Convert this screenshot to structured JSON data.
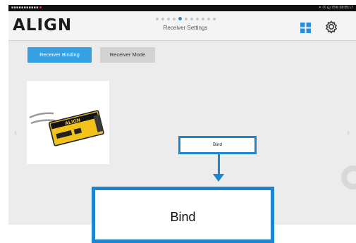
{
  "status_bar": {
    "left": "■■■■■■■■■■■",
    "right": "✶ ⦿ ⨀ 75% 08:05:17"
  },
  "header": {
    "logo": "ALIGN",
    "title": "Receiver Settings",
    "page_dots_total": 11,
    "page_dots_active": 4
  },
  "tabs": [
    {
      "label": "Receiver Binding",
      "selected": true
    },
    {
      "label": "Receiver Mode",
      "selected": false
    }
  ],
  "receiver_image": {
    "label": "ALIGN"
  },
  "bind_button": {
    "label": "Bind"
  },
  "bind_callout": {
    "label": "Bind"
  },
  "colors": {
    "accent": "#1d86cf",
    "tab_active": "#35a0e3",
    "receiver_body": "#f2c21b"
  },
  "icons": {
    "grid": "grid-icon",
    "settings": "gear-icon",
    "prev": "chevron-left-icon",
    "next": "chevron-right-icon"
  }
}
